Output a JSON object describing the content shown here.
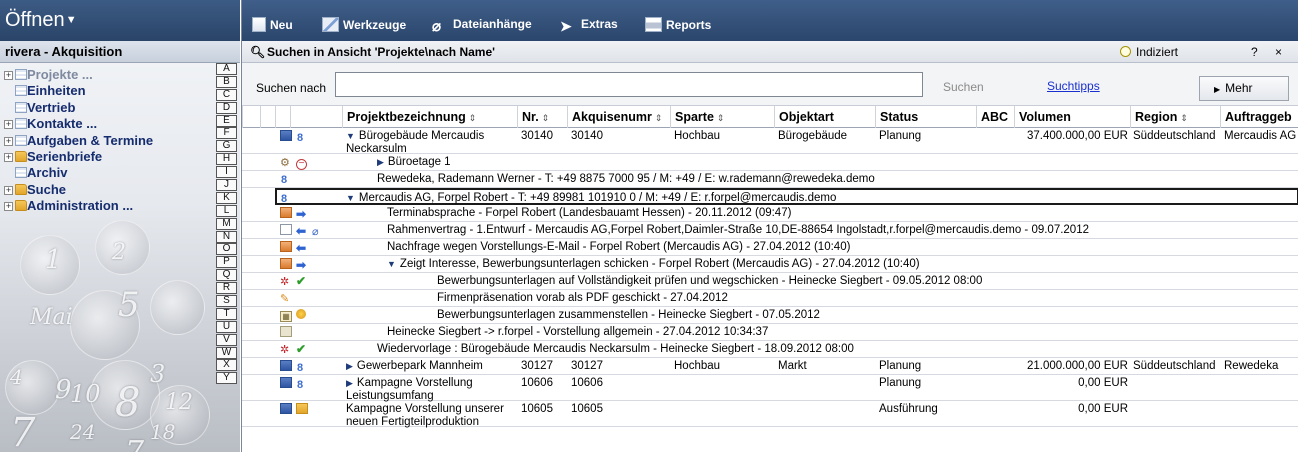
{
  "left": {
    "header": "Öffnen",
    "context": "rivera  - Akquisition",
    "tree": [
      {
        "label": "Projekte ...",
        "icon": "grid-icon",
        "expandable": true,
        "dim": true
      },
      {
        "label": "Einheiten",
        "icon": "grid-icon",
        "expandable": false
      },
      {
        "label": "Vertrieb",
        "icon": "grid-icon",
        "expandable": false
      },
      {
        "label": "Kontakte ...",
        "icon": "grid-icon",
        "expandable": true
      },
      {
        "label": "Aufgaben & Termine",
        "icon": "grid-icon",
        "expandable": true
      },
      {
        "label": "Serienbriefe",
        "icon": "folder-icon",
        "expandable": true
      },
      {
        "label": "Archiv",
        "icon": "grid-icon",
        "expandable": false
      },
      {
        "label": "Suche",
        "icon": "folder-icon",
        "expandable": true
      },
      {
        "label": "Administration ...",
        "icon": "folder-icon",
        "expandable": true
      }
    ],
    "alphabet": [
      "A",
      "B",
      "C",
      "D",
      "E",
      "F",
      "G",
      "H",
      "I",
      "J",
      "K",
      "L",
      "M",
      "N",
      "O",
      "P",
      "Q",
      "R",
      "S",
      "T",
      "U",
      "V",
      "W",
      "X",
      "Y"
    ],
    "deco_digits": [
      "1",
      "2",
      "5",
      "Mai",
      "9",
      "3",
      "10",
      "8",
      "7",
      "12",
      "24",
      "18",
      "4",
      "7"
    ]
  },
  "toolbar": {
    "new": "Neu",
    "tools": "Werkzeuge",
    "attachments": "Dateianhänge",
    "extras": "Extras",
    "reports": "Reports"
  },
  "search": {
    "title": "Suchen in Ansicht 'Projekte\\nach Name'",
    "indexed": "Indiziert",
    "help": "?",
    "close": "×",
    "label": "Suchen nach",
    "value": "",
    "button": "Suchen",
    "tips": "Suchtipps",
    "more": "Mehr"
  },
  "columns": [
    "Projektbezeichnung",
    "Nr.",
    "Akquisenumr",
    "Sparte",
    "Objektart",
    "Status",
    "ABC",
    "Volumen",
    "Region",
    "Auftraggeb"
  ],
  "rows": [
    {
      "indent": 0,
      "icons": [
        "doc-icon",
        "person-icon"
      ],
      "expander": "▼",
      "text": "Bürogebäude Mercaudis Neckarsulm",
      "nr": "30140",
      "akq": "30140",
      "sparte": "Hochbau",
      "objekt": "Bürogebäude",
      "status": "Planung",
      "volumen": "37.400.000,00 EUR",
      "region": "Süddeutschland",
      "auftrag": "Mercaudis AG"
    },
    {
      "indent": 1,
      "icons": [
        "gears-icon",
        "minus-icon"
      ],
      "expander": "▶",
      "text": "Büroetage 1"
    },
    {
      "indent": 1,
      "icons": [
        "person-icon"
      ],
      "expander": "",
      "text": "Rewedeka, Rademann Werner - T: +49 8875 7000 95 / M: +49 / E: w.rademann@rewedeka.demo"
    },
    {
      "indent": 0,
      "icons": [
        "person-icon"
      ],
      "expander": "▼",
      "text": "Mercaudis AG, Forpel Robert - T: +49 89981 101910 0 / M: +49 / E: r.forpel@mercaudis.demo",
      "selected": true
    },
    {
      "indent": 2,
      "icons": [
        "calendar-icon",
        "arrow-right-icon"
      ],
      "expander": "",
      "text": "Terminabsprache - Forpel Robert (Landesbauamt Hessen)  - 20.11.2012 (09:47)"
    },
    {
      "indent": 2,
      "icons": [
        "mail-icon",
        "arrow-left-icon",
        "paperclip-icon"
      ],
      "expander": "",
      "text": "Rahmenvertrag - 1.Entwurf - Mercaudis AG,Forpel Robert,Daimler-Straße 10,DE-88654 Ingolstadt,r.forpel@mercaudis.demo - 09.07.2012"
    },
    {
      "indent": 2,
      "icons": [
        "calendar-icon",
        "arrow-left-icon"
      ],
      "expander": "",
      "text": "Nachfrage wegen Vorstellungs-E-Mail - Forpel Robert (Mercaudis AG)  - 27.04.2012 (10:40)"
    },
    {
      "indent": 2,
      "icons": [
        "calendar-icon",
        "arrow-right-icon"
      ],
      "expander": "▼",
      "text": "Zeigt Interesse, Bewerbungsunterlagen schicken - Forpel Robert (Mercaudis AG)  - 27.04.2012 (10:40)"
    },
    {
      "indent": 3,
      "icons": [
        "task-icon",
        "check-icon"
      ],
      "expander": "",
      "text": "Bewerbungsunterlagen auf Vollständigkeit prüfen und wegschicken - Heinecke Siegbert - 09.05.2012 08:00"
    },
    {
      "indent": 3,
      "icons": [
        "pencil-icon"
      ],
      "expander": "",
      "text": "Firmenpräsenation vorab als PDF geschickt - 27.04.2012"
    },
    {
      "indent": 3,
      "icons": [
        "box-icon",
        "coin-icon"
      ],
      "expander": "",
      "text": "Bewerbungsunterlagen zusammenstellen - Heinecke Siegbert - 07.05.2012"
    },
    {
      "indent": 2,
      "icons": [
        "note-icon"
      ],
      "expander": "",
      "text": "Heinecke Siegbert -> r.forpel - Vorstellung allgemein - 27.04.2012 10:34:37"
    },
    {
      "indent": 1,
      "icons": [
        "task-icon",
        "check-icon"
      ],
      "expander": "",
      "text": "Wiedervorlage : Bürogebäude Mercaudis Neckarsulm - Heinecke Siegbert - 18.09.2012 08:00"
    },
    {
      "indent": 0,
      "icons": [
        "doc-icon",
        "person-icon"
      ],
      "expander": "▶",
      "text": "Gewerbepark Mannheim",
      "nr": "30127",
      "akq": "30127",
      "sparte": "Hochbau",
      "objekt": "Markt",
      "status": "Planung",
      "volumen": "21.000.000,00 EUR",
      "region": "Süddeutschland",
      "auftrag": "Rewedeka"
    },
    {
      "indent": 0,
      "icons": [
        "doc-icon",
        "person-icon"
      ],
      "expander": "▶",
      "text": "Kampagne Vorstellung Leistungsumfang",
      "nr": "10606",
      "akq": "10606",
      "sparte": "",
      "objekt": "",
      "status": "Planung",
      "volumen": "0,00 EUR",
      "region": "",
      "auftrag": ""
    },
    {
      "indent": 0,
      "icons": [
        "doc-icon",
        "folder-icon"
      ],
      "expander": "",
      "text": "Kampagne Vorstellung unserer neuen Fertigteilproduktion",
      "nr": "10605",
      "akq": "10605",
      "sparte": "",
      "objekt": "",
      "status": "Ausführung",
      "volumen": "0,00 EUR",
      "region": "",
      "auftrag": ""
    }
  ]
}
